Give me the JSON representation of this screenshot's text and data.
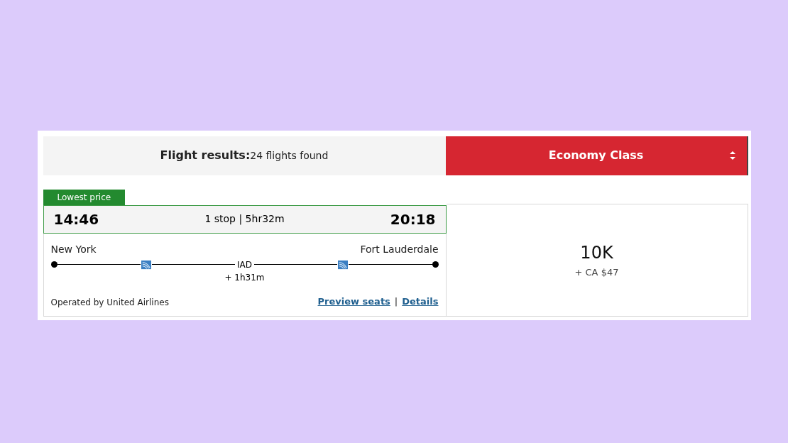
{
  "header": {
    "title": "Flight results:",
    "count": "24 flights found"
  },
  "cabin_select": {
    "value": "Economy Class"
  },
  "flight": {
    "badge": "Lowest price",
    "departure_time": "14:46",
    "summary": "1 stop | 5hr32m",
    "arrival_time": "20:18",
    "origin": "New York",
    "destination": "Fort Lauderdale",
    "stop": "IAD",
    "layover": "+ 1h31m",
    "operator": "Operated by United Airlines",
    "links": [
      "Preview seats",
      "Details"
    ],
    "separator": "|"
  },
  "price": {
    "points": "10K",
    "fee": "+ CA $47"
  }
}
